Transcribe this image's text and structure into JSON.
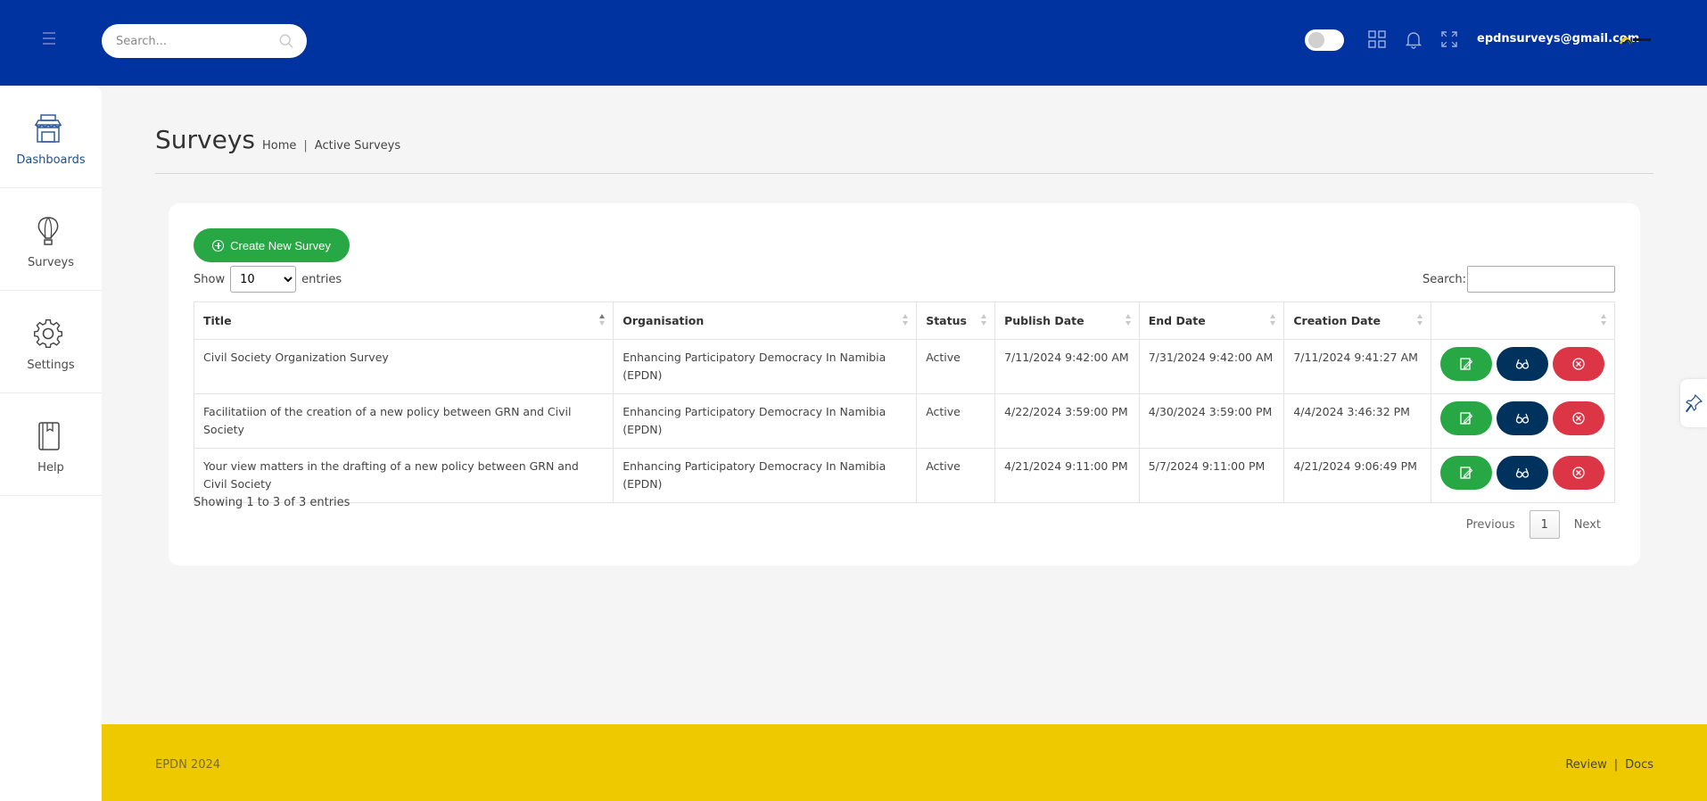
{
  "header": {
    "search_placeholder": "Search...",
    "user_email": "epdnsurveys@gmail.com"
  },
  "sidebar": {
    "items": [
      {
        "label": "Dashboards",
        "icon": "store-icon"
      },
      {
        "label": "Surveys",
        "icon": "hot-air-balloon-icon"
      },
      {
        "label": "Settings",
        "icon": "gear-icon"
      },
      {
        "label": "Help",
        "icon": "book-icon"
      }
    ]
  },
  "page": {
    "title": "Surveys",
    "breadcrumb": [
      "Home",
      "Active Surveys"
    ]
  },
  "card": {
    "create_button": "Create New Survey",
    "show_label": "Show",
    "entries_label": "entries",
    "page_size": "10",
    "search_label": "Search:",
    "columns": [
      "Title",
      "Organisation",
      "Status",
      "Publish Date",
      "End Date",
      "Creation Date",
      ""
    ],
    "rows": [
      {
        "title": "Civil Society Organization Survey",
        "organisation": "Enhancing Participatory Democracy In Namibia (EPDN)",
        "status": "Active",
        "publish_date": "7/11/2024 9:42:00 AM",
        "end_date": "7/31/2024 9:42:00 AM",
        "creation_date": "7/11/2024 9:41:27 AM"
      },
      {
        "title": "Facilitatiion of the creation of a new policy between GRN and Civil Society",
        "organisation": "Enhancing Participatory Democracy In Namibia (EPDN)",
        "status": "Active",
        "publish_date": "4/22/2024 3:59:00 PM",
        "end_date": "4/30/2024 3:59:00 PM",
        "creation_date": "4/4/2024 3:46:32 PM"
      },
      {
        "title": "Your view matters in the drafting of a new policy between GRN and Civil Society",
        "organisation": "Enhancing Participatory Democracy In Namibia (EPDN)",
        "status": "Active",
        "publish_date": "4/21/2024 9:11:00 PM",
        "end_date": "5/7/2024 9:11:00 PM",
        "creation_date": "4/21/2024 9:06:49 PM"
      }
    ],
    "info": "Showing 1 to 3 of 3 entries",
    "pagination": {
      "previous": "Previous",
      "current": "1",
      "next": "Next"
    }
  },
  "footer": {
    "copyright": "EPDN 2024",
    "links": [
      "Review",
      "Docs"
    ]
  },
  "colors": {
    "header_bg": "#0033a0",
    "footer_bg": "#eec900",
    "create_green": "#28a745",
    "view_navy": "#00325e",
    "delete_red": "#dc3545"
  }
}
